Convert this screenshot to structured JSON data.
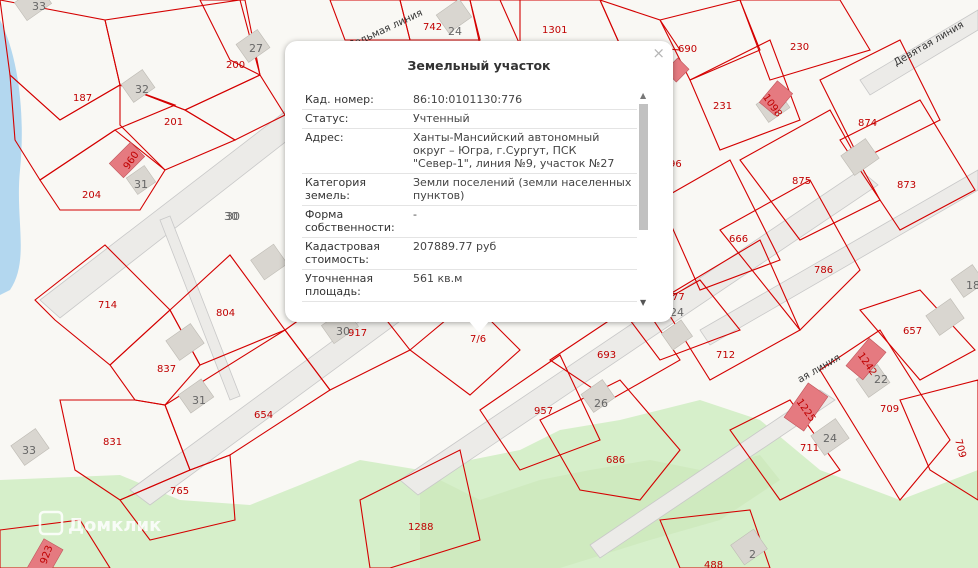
{
  "map": {
    "plot_numbers": [
      "187",
      "200",
      "201",
      "204",
      "714",
      "804",
      "837",
      "831",
      "654",
      "765",
      "917",
      "1288",
      "957",
      "686",
      "693",
      "712",
      "786",
      "666",
      "875",
      "873",
      "874",
      "231",
      "690",
      "230",
      "657",
      "709",
      "711",
      "709",
      "488",
      "1301",
      "742",
      "30",
      "7/6",
      "77",
      "96"
    ],
    "cadastral_codes": [
      "960",
      "1098",
      "1242",
      "1225",
      "923"
    ],
    "house_numbers": [
      "33",
      "27",
      "32",
      "31",
      "24",
      "30",
      "30",
      "31",
      "33",
      "26",
      "22",
      "24",
      "18",
      "2",
      "24"
    ],
    "street_labels": [
      "Девятая линия",
      "Седьмая линия",
      "ая линия"
    ],
    "watermark": "Домклик",
    "colors": {
      "plot_border": "#d40000",
      "map_bg": "#f9f8f4",
      "water": "#b3d7ef",
      "green": "#d6efca",
      "road": "#eeeeec",
      "building": "#d9d6d0",
      "cadastral_building": "#e57a80"
    }
  },
  "popup": {
    "title": "Земельный участок",
    "close_label": "×",
    "fields": [
      {
        "key": "Кад. номер:",
        "value": "86:10:0101130:776"
      },
      {
        "key": "Статус:",
        "value": "Учтенный"
      },
      {
        "key": "Адрес:",
        "value": "Ханты-Мансийский автономный округ – Югра, г.Сургут, ПСК \"Север-1\", линия №9, участок №27"
      },
      {
        "key": "Категория земель:",
        "value": "Земли поселений (земли населенных пунктов)"
      },
      {
        "key": "Форма собственности:",
        "value": "-"
      },
      {
        "key": "Кадастровая стоимость:",
        "value": "207889.77 руб"
      },
      {
        "key": "Уточненная площадь:",
        "value": "561 кв.м"
      }
    ],
    "scroll_position": 0.0
  }
}
